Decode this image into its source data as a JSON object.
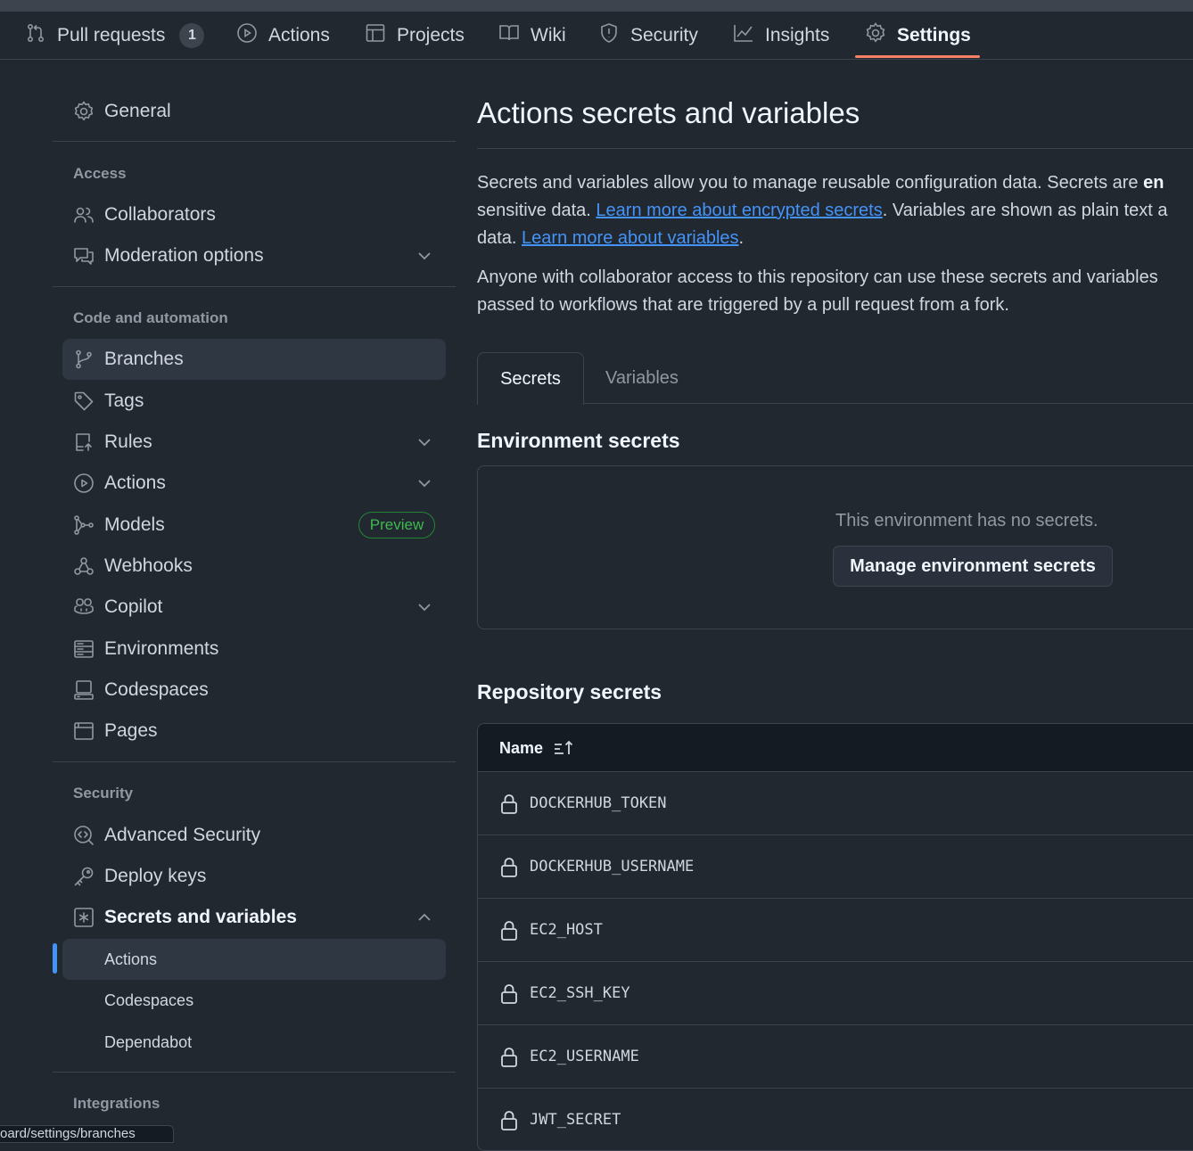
{
  "repo_nav": {
    "tabs": [
      {
        "label": "Pull requests",
        "icon": "pull-request-icon",
        "counter": "1"
      },
      {
        "label": "Actions",
        "icon": "play-icon"
      },
      {
        "label": "Projects",
        "icon": "table-icon"
      },
      {
        "label": "Wiki",
        "icon": "book-icon"
      },
      {
        "label": "Security",
        "icon": "shield-icon"
      },
      {
        "label": "Insights",
        "icon": "graph-icon"
      },
      {
        "label": "Settings",
        "icon": "gear-icon",
        "selected": true
      }
    ]
  },
  "sidebar": {
    "general": "General",
    "groups": {
      "access": "Access",
      "code_automation": "Code and automation",
      "security": "Security",
      "integrations": "Integrations"
    },
    "items": {
      "collaborators": "Collaborators",
      "moderation": "Moderation options",
      "branches": "Branches",
      "tags": "Tags",
      "rules": "Rules",
      "actions": "Actions",
      "models": "Models",
      "models_badge": "Preview",
      "webhooks": "Webhooks",
      "copilot": "Copilot",
      "environments": "Environments",
      "codespaces": "Codespaces",
      "pages": "Pages",
      "advanced_security": "Advanced Security",
      "deploy_keys": "Deploy keys",
      "secrets_variables": "Secrets and variables"
    },
    "sub_items": {
      "actions": "Actions",
      "codespaces": "Codespaces",
      "dependabot": "Dependabot"
    }
  },
  "main": {
    "title": "Actions secrets and variables",
    "intro": {
      "line1_a": "Secrets and variables allow you to manage reusable configuration data. Secrets are ",
      "line1_b": "en",
      "line2_a": "sensitive data. ",
      "link1": "Learn more about encrypted secrets",
      "line2_b": ". Variables are shown as plain text a",
      "line3_a": "data. ",
      "link2": "Learn more about variables",
      "line3_b": "."
    },
    "notice": {
      "line1": "Anyone with collaborator access to this repository can use these secrets and variables",
      "line2": "passed to workflows that are triggered by a pull request from a fork."
    },
    "tabs": {
      "secrets": "Secrets",
      "variables": "Variables"
    },
    "env_secrets": {
      "heading": "Environment secrets",
      "empty": "This environment has no secrets.",
      "button": "Manage environment secrets"
    },
    "repo_secrets": {
      "heading": "Repository secrets",
      "column": "Name",
      "rows": [
        "DOCKERHUB_TOKEN",
        "DOCKERHUB_USERNAME",
        "EC2_HOST",
        "EC2_SSH_KEY",
        "EC2_USERNAME",
        "JWT_SECRET"
      ]
    }
  },
  "status_bar": {
    "url": "oard/settings/branches"
  },
  "colors": {
    "background": "#212830",
    "accent_underline": "#f78166",
    "link": "#4493f8",
    "active_bar": "#4493f8",
    "badge_green": "#3fb950"
  }
}
